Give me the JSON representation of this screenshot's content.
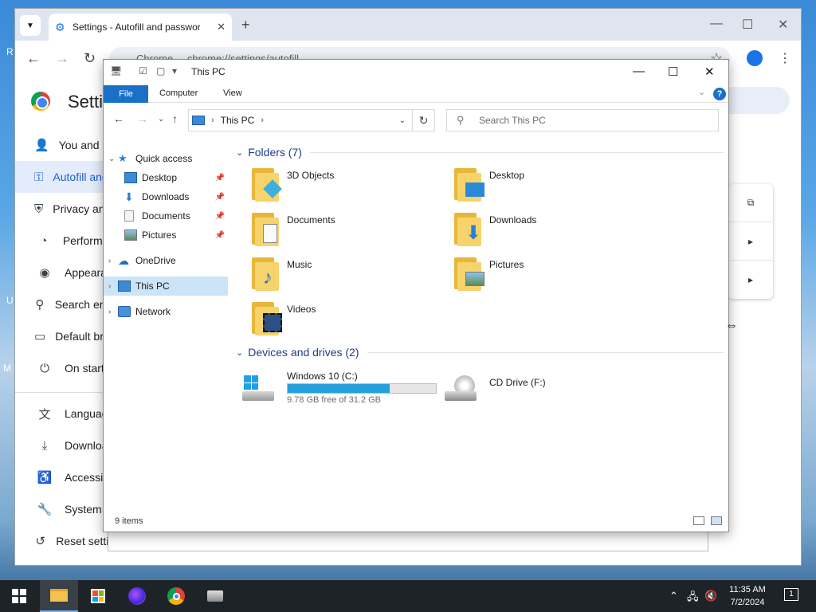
{
  "desktop": {
    "edge_letters": [
      "R",
      "U",
      "M"
    ]
  },
  "chrome": {
    "tab_title": "Settings - Autofill and passwords",
    "url": "chrome://settings/autofill",
    "omnibox_label": "Chrome",
    "settings_title": "Settings",
    "nav": [
      {
        "label": "You and Google",
        "icon": "person-icon"
      },
      {
        "label": "Autofill and passwords",
        "icon": "key-icon"
      },
      {
        "label": "Privacy and security",
        "icon": "shield-icon"
      },
      {
        "label": "Performance",
        "icon": "speedometer-icon"
      },
      {
        "label": "Appearance",
        "icon": "palette-icon"
      },
      {
        "label": "Search engine",
        "icon": "search-icon"
      },
      {
        "label": "Default browser",
        "icon": "browser-icon"
      },
      {
        "label": "On startup",
        "icon": "power-icon"
      },
      {
        "label": "Languages",
        "icon": "translate-icon"
      },
      {
        "label": "Downloads",
        "icon": "download-icon"
      },
      {
        "label": "Accessibility",
        "icon": "accessibility-icon"
      },
      {
        "label": "System",
        "icon": "wrench-icon"
      },
      {
        "label": "Reset settings",
        "icon": "reset-icon"
      }
    ]
  },
  "explorer": {
    "window_title": "This PC",
    "ribbon_tabs": [
      "File",
      "Computer",
      "View"
    ],
    "breadcrumb": "This PC",
    "search_placeholder": "Search This PC",
    "nav_pane": {
      "quick_access": "Quick access",
      "pinned": [
        "Desktop",
        "Downloads",
        "Documents",
        "Pictures"
      ],
      "onedrive": "OneDrive",
      "this_pc": "This PC",
      "network": "Network"
    },
    "folders_header": "Folders (7)",
    "folders": [
      "3D Objects",
      "Desktop",
      "Documents",
      "Downloads",
      "Music",
      "Pictures",
      "Videos"
    ],
    "devices_header": "Devices and drives (2)",
    "drives": [
      {
        "name": "Windows 10 (C:)",
        "free_text": "9.78 GB free of 31.2 GB",
        "used_fraction": 0.69
      },
      {
        "name": "CD Drive (F:)"
      }
    ],
    "status": "9 items"
  },
  "taskbar": {
    "time": "11:35 AM",
    "date": "7/2/2024",
    "notification_count": "1"
  }
}
